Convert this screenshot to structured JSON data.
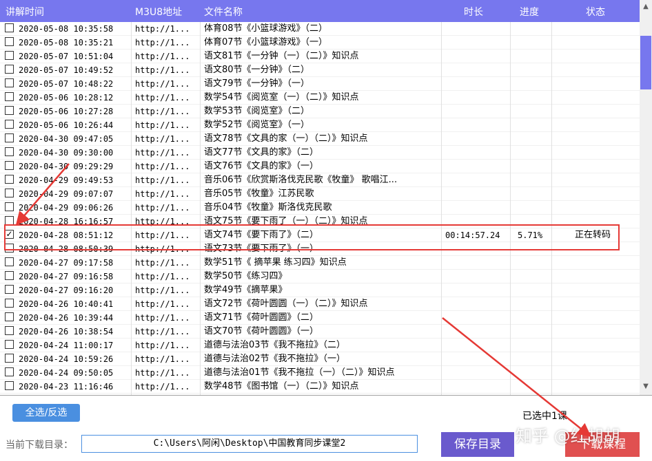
{
  "header": {
    "time": "讲解时间",
    "m3u8": "M3U8地址",
    "filename": "文件名称",
    "duration": "时长",
    "progress": "进度",
    "status": "状态"
  },
  "rows": [
    {
      "time": "2020-05-08 10:35:58",
      "url": "http://1...",
      "name": "体育08节《小篮球游戏》（二）",
      "duration": "",
      "progress": "",
      "status": "",
      "checked": false
    },
    {
      "time": "2020-05-08 10:35:21",
      "url": "http://1...",
      "name": "体育07节《小篮球游戏》（一）",
      "duration": "",
      "progress": "",
      "status": "",
      "checked": false
    },
    {
      "time": "2020-05-07 10:51:04",
      "url": "http://1...",
      "name": "语文81节《一分钟（一）（二）》知识点",
      "duration": "",
      "progress": "",
      "status": "",
      "checked": false
    },
    {
      "time": "2020-05-07 10:49:52",
      "url": "http://1...",
      "name": "语文80节《一分钟》（二）",
      "duration": "",
      "progress": "",
      "status": "",
      "checked": false
    },
    {
      "time": "2020-05-07 10:48:22",
      "url": "http://1...",
      "name": "语文79节《一分钟》（一）",
      "duration": "",
      "progress": "",
      "status": "",
      "checked": false
    },
    {
      "time": "2020-05-06 10:28:12",
      "url": "http://1...",
      "name": "数学54节《阅览室（一）（二）》知识点",
      "duration": "",
      "progress": "",
      "status": "",
      "checked": false
    },
    {
      "time": "2020-05-06 10:27:28",
      "url": "http://1...",
      "name": "数学53节《阅览室》（二）",
      "duration": "",
      "progress": "",
      "status": "",
      "checked": false
    },
    {
      "time": "2020-05-06 10:26:44",
      "url": "http://1...",
      "name": "数学52节《阅览室》（一）",
      "duration": "",
      "progress": "",
      "status": "",
      "checked": false
    },
    {
      "time": "2020-04-30 09:47:05",
      "url": "http://1...",
      "name": "语文78节《文具的家（一）（二）》知识点",
      "duration": "",
      "progress": "",
      "status": "",
      "checked": false
    },
    {
      "time": "2020-04-30 09:30:00",
      "url": "http://1...",
      "name": "语文77节《文具的家》（二）",
      "duration": "",
      "progress": "",
      "status": "",
      "checked": false
    },
    {
      "time": "2020-04-30 09:29:29",
      "url": "http://1...",
      "name": "语文76节《文具的家》（一）",
      "duration": "",
      "progress": "",
      "status": "",
      "checked": false
    },
    {
      "time": "2020-04-29 09:49:53",
      "url": "http://1...",
      "name": "音乐06节《欣赏斯洛伐克民歌《牧童》 歌唱江...",
      "duration": "",
      "progress": "",
      "status": "",
      "checked": false
    },
    {
      "time": "2020-04-29 09:07:07",
      "url": "http://1...",
      "name": "音乐05节《牧童》江苏民歌",
      "duration": "",
      "progress": "",
      "status": "",
      "checked": false
    },
    {
      "time": "2020-04-29 09:06:26",
      "url": "http://1...",
      "name": "音乐04节《牧童》斯洛伐克民歌",
      "duration": "",
      "progress": "",
      "status": "",
      "checked": false
    },
    {
      "time": "2020-04-28 16:16:57",
      "url": "http://1...",
      "name": "语文75节《要下雨了（一）（二）》知识点",
      "duration": "",
      "progress": "",
      "status": "",
      "checked": false
    },
    {
      "time": "2020-04-28 08:51:12",
      "url": "http://1...",
      "name": "语文74节《要下雨了》（二）",
      "duration": "00:14:57.24",
      "progress": "5.71%",
      "status": "正在转码",
      "checked": true
    },
    {
      "time": "2020-04-28 08:50:39",
      "url": "http://1...",
      "name": "语文73节《要下雨了》（一）",
      "duration": "",
      "progress": "",
      "status": "",
      "checked": false
    },
    {
      "time": "2020-04-27 09:17:58",
      "url": "http://1...",
      "name": "数学51节《 摘苹果 练习四》知识点",
      "duration": "",
      "progress": "",
      "status": "",
      "checked": false
    },
    {
      "time": "2020-04-27 09:16:58",
      "url": "http://1...",
      "name": "数学50节《练习四》",
      "duration": "",
      "progress": "",
      "status": "",
      "checked": false
    },
    {
      "time": "2020-04-27 09:16:20",
      "url": "http://1...",
      "name": "数学49节《摘苹果》",
      "duration": "",
      "progress": "",
      "status": "",
      "checked": false
    },
    {
      "time": "2020-04-26 10:40:41",
      "url": "http://1...",
      "name": "语文72节《荷叶圆圆（一）（二）》知识点",
      "duration": "",
      "progress": "",
      "status": "",
      "checked": false
    },
    {
      "time": "2020-04-26 10:39:44",
      "url": "http://1...",
      "name": "语文71节《荷叶圆圆》（二）",
      "duration": "",
      "progress": "",
      "status": "",
      "checked": false
    },
    {
      "time": "2020-04-26 10:38:54",
      "url": "http://1...",
      "name": "语文70节《荷叶圆圆》（一）",
      "duration": "",
      "progress": "",
      "status": "",
      "checked": false
    },
    {
      "time": "2020-04-24 11:00:17",
      "url": "http://1...",
      "name": "道德与法治03节《我不拖拉》（二）",
      "duration": "",
      "progress": "",
      "status": "",
      "checked": false
    },
    {
      "time": "2020-04-24 10:59:26",
      "url": "http://1...",
      "name": "道德与法治02节《我不拖拉》（一）",
      "duration": "",
      "progress": "",
      "status": "",
      "checked": false
    },
    {
      "time": "2020-04-24 09:50:05",
      "url": "http://1...",
      "name": "道德与法治01节《我不拖拉（一）（二）》知识点",
      "duration": "",
      "progress": "",
      "status": "",
      "checked": false
    },
    {
      "time": "2020-04-23 11:16:46",
      "url": "http://1...",
      "name": "数学48节《图书馆（一）（二）》知识点",
      "duration": "",
      "progress": "",
      "status": "",
      "checked": false
    }
  ],
  "controls": {
    "select_toggle": "全选/反选",
    "selected_count": "已选中1课",
    "dir_label": "当前下载目录：",
    "dir_value": "C:\\Users\\阿闲\\Desktop\\中国教育同步课堂2",
    "save_dir": "保存目录",
    "download": "下载课程"
  },
  "watermark": "知乎 @红胡胡",
  "icons": {
    "checkbox_checked": "✓",
    "scroll_up": "▲",
    "scroll_down": "▼"
  },
  "colors": {
    "header_bg": "#7777ee",
    "select_button": "#4a8fe0",
    "save_button": "#6a5acd",
    "download_button": "#e05050",
    "annotation": "#e53935"
  }
}
